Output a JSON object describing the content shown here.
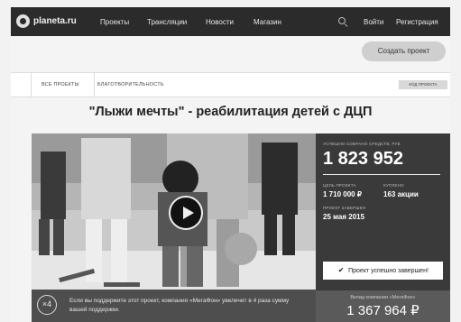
{
  "nav": {
    "logo": "planeta.ru",
    "items": [
      "Проекты",
      "Трансляции",
      "Новости",
      "Магазин"
    ],
    "login": "Войти",
    "register": "Регистрация"
  },
  "create_button": "Создать проект",
  "filters": {
    "all": "ВСЕ ПРОЕКТЫ",
    "charity": "БЛАГОТВОРИТЕЛЬНОСТЬ",
    "code": "КОД ПРОЕКТА"
  },
  "title": "\"Лыжи мечты\" - реабилитация детей с ДЦП",
  "promo": {
    "badge": "×4",
    "text": "Если вы поддержите этот проект, компания «МегаФон» увеличит в 4 раза сумму вашей поддержки."
  },
  "stats": {
    "collected_label": "УСПЕШНО СОБРАНО СРЕДСТВ, РУБ",
    "collected": "1 823 952",
    "goal_label": "ЦЕЛЬ ПРОЕКТА",
    "goal": "1 710 000 ₽",
    "bought_label": "КУПЛЕНО",
    "bought": "163 акции",
    "ended_label": "ПРОЕКТ ЗАВЕРШЕН",
    "ended": "25 мая 2015",
    "progress": 1.0,
    "done": "Проект успешно завершен!"
  },
  "contribution": {
    "label": "Вклад компании «МегаФон»",
    "value": "1 367 964 ₽"
  },
  "colors": {
    "nav_bg": "#2b2b2b",
    "panel_bg": "#3a3a3a"
  }
}
